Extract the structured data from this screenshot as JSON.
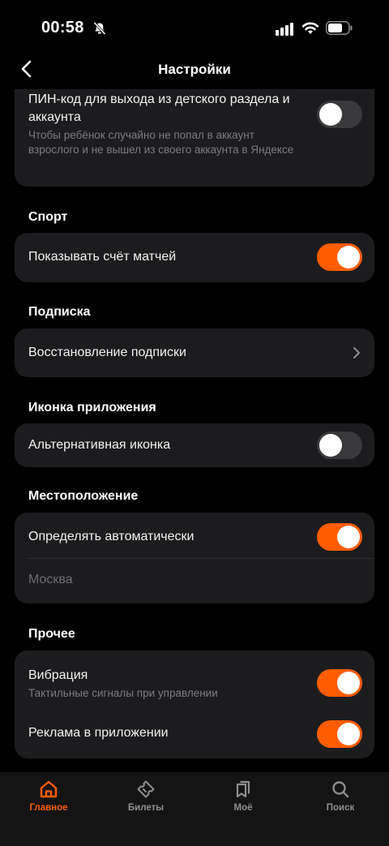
{
  "status": {
    "time": "00:58"
  },
  "nav": {
    "title": "Настройки"
  },
  "kids_pin": {
    "title": "ПИН-код для выхода из детского раздела и аккаунта",
    "subtitle": "Чтобы ребёнок случайно не попал в аккаунт взрослого и не вышел из своего аккаунта в Яндексе",
    "enabled": false
  },
  "sport": {
    "section_title": "Спорт",
    "show_scores_label": "Показывать счёт матчей",
    "show_scores_enabled": true
  },
  "subscription": {
    "section_title": "Подписка",
    "restore_label": "Восстановление подписки"
  },
  "app_icon": {
    "section_title": "Иконка приложения",
    "alt_icon_label": "Альтернативная иконка",
    "alt_icon_enabled": false
  },
  "location": {
    "section_title": "Местоположение",
    "auto_label": "Определять автоматически",
    "auto_enabled": true,
    "city": "Москва"
  },
  "other": {
    "section_title": "Прочее",
    "vibration_label": "Вибрация",
    "vibration_sub": "Тактильные сигналы при управлении",
    "vibration_enabled": true,
    "ads_label": "Реклама в приложении",
    "ads_enabled": true
  },
  "tabs": [
    {
      "label": "Главное",
      "icon": "home-icon",
      "active": true
    },
    {
      "label": "Билеты",
      "icon": "ticket-icon",
      "active": false
    },
    {
      "label": "Моё",
      "icon": "bookmarks-icon",
      "active": false
    },
    {
      "label": "Поиск",
      "icon": "search-icon",
      "active": false
    }
  ],
  "colors": {
    "accent": "#ff5c00",
    "card": "#1c1c1e",
    "background": "#000000"
  }
}
